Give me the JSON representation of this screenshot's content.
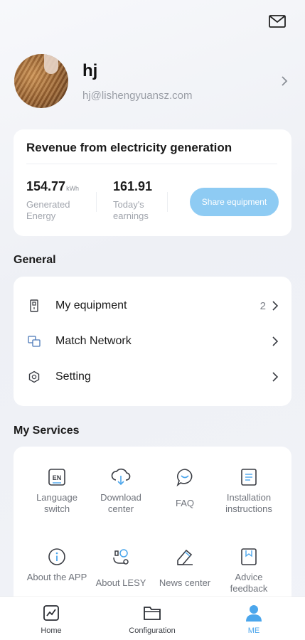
{
  "profile": {
    "name": "hj",
    "email": "hj@lishengyuansz.com"
  },
  "revenue": {
    "title": "Revenue from electricity generation",
    "energy_value": "154.77",
    "energy_unit": "kWh",
    "energy_label": "Generated Energy",
    "earnings_value": "161.91",
    "earnings_label": "Today's earnings",
    "share_label": "Share equipment"
  },
  "general": {
    "title": "General",
    "items": [
      {
        "label": "My equipment",
        "count": "2",
        "icon": "equipment-icon"
      },
      {
        "label": "Match Network",
        "icon": "match-network-icon"
      },
      {
        "label": "Setting",
        "icon": "settings-icon"
      }
    ]
  },
  "services": {
    "title": "My Services",
    "items": [
      {
        "label": "Language switch",
        "icon": "language-icon"
      },
      {
        "label": "Download center",
        "icon": "download-icon"
      },
      {
        "label": "FAQ",
        "icon": "faq-icon"
      },
      {
        "label": "Installation instructions",
        "icon": "instructions-icon"
      },
      {
        "label": "About the APP",
        "icon": "info-icon"
      },
      {
        "label": "About LESY",
        "icon": "about-lesy-icon"
      },
      {
        "label": "News center",
        "icon": "news-icon"
      },
      {
        "label": "Advice feedback",
        "icon": "feedback-icon"
      }
    ]
  },
  "tabs": [
    {
      "label": "Home",
      "icon": "home-chart-icon"
    },
    {
      "label": "Configuration",
      "icon": "folder-icon"
    },
    {
      "label": "ME",
      "icon": "person-icon",
      "active": true
    }
  ],
  "colors": {
    "accent": "#4ba6ec",
    "share_button": "#8ecbf3",
    "background": "#f1f3f8",
    "card": "#ffffff"
  }
}
